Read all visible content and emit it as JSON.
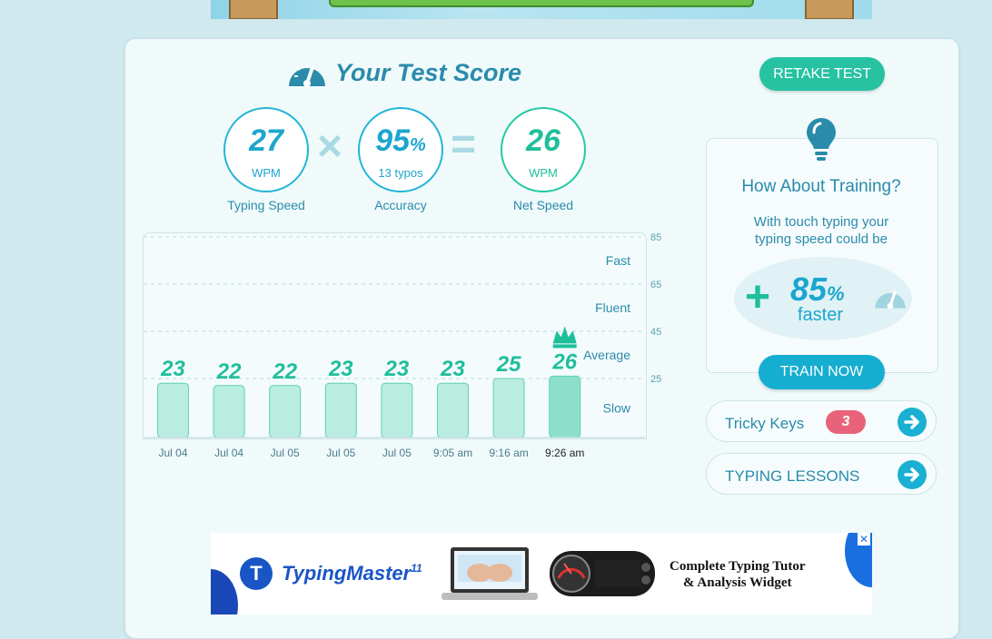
{
  "title": "Your Test Score",
  "retake_label": "RETAKE TEST",
  "stats": [
    {
      "value": "27",
      "unit": "WPM",
      "label": "Typing Speed"
    },
    {
      "value": "95",
      "suffix": "%",
      "unit": "13 typos",
      "label": "Accuracy"
    },
    {
      "value": "26",
      "unit": "WPM",
      "label": "Net Speed"
    }
  ],
  "operators": {
    "times": "×",
    "equals": "="
  },
  "chart_data": {
    "type": "bar",
    "categories": [
      "Jul 04",
      "Jul 04",
      "Jul 05",
      "Jul 05",
      "Jul 05",
      "9:05 am",
      "9:16 am",
      "9:26 am"
    ],
    "values": [
      23,
      22,
      22,
      23,
      23,
      23,
      25,
      26
    ],
    "highlight_index": 7,
    "ylim": [
      0,
      85
    ],
    "yticks": [
      25,
      45,
      65,
      85
    ],
    "bands": [
      "Slow",
      "Average",
      "Fluent",
      "Fast"
    ],
    "colors": {
      "bar": "#b9ede0",
      "bar_highlight": "#8ee0cb",
      "label": "#1fbf9c"
    }
  },
  "training": {
    "title": "How About Training?",
    "text_line1": "With touch typing your",
    "text_line2": "typing speed could be",
    "plus": "+",
    "percent": "85",
    "percent_sign": "%",
    "faster": "faster",
    "button": "TRAIN NOW"
  },
  "tricky_keys": {
    "label": "Tricky Keys",
    "count": "3"
  },
  "lessons": {
    "label": "TYPING LESSONS"
  },
  "ad": {
    "brand": "TypingMaster",
    "version": "11",
    "logo_letter": "T",
    "tagline_line1": "Complete Typing Tutor",
    "tagline_line2": "& Analysis Widget",
    "close": "✕"
  },
  "colors": {
    "accent": "#2a8bab",
    "green": "#1fbf9c",
    "blue": "#1ca6cf",
    "badge": "#e8637a"
  }
}
